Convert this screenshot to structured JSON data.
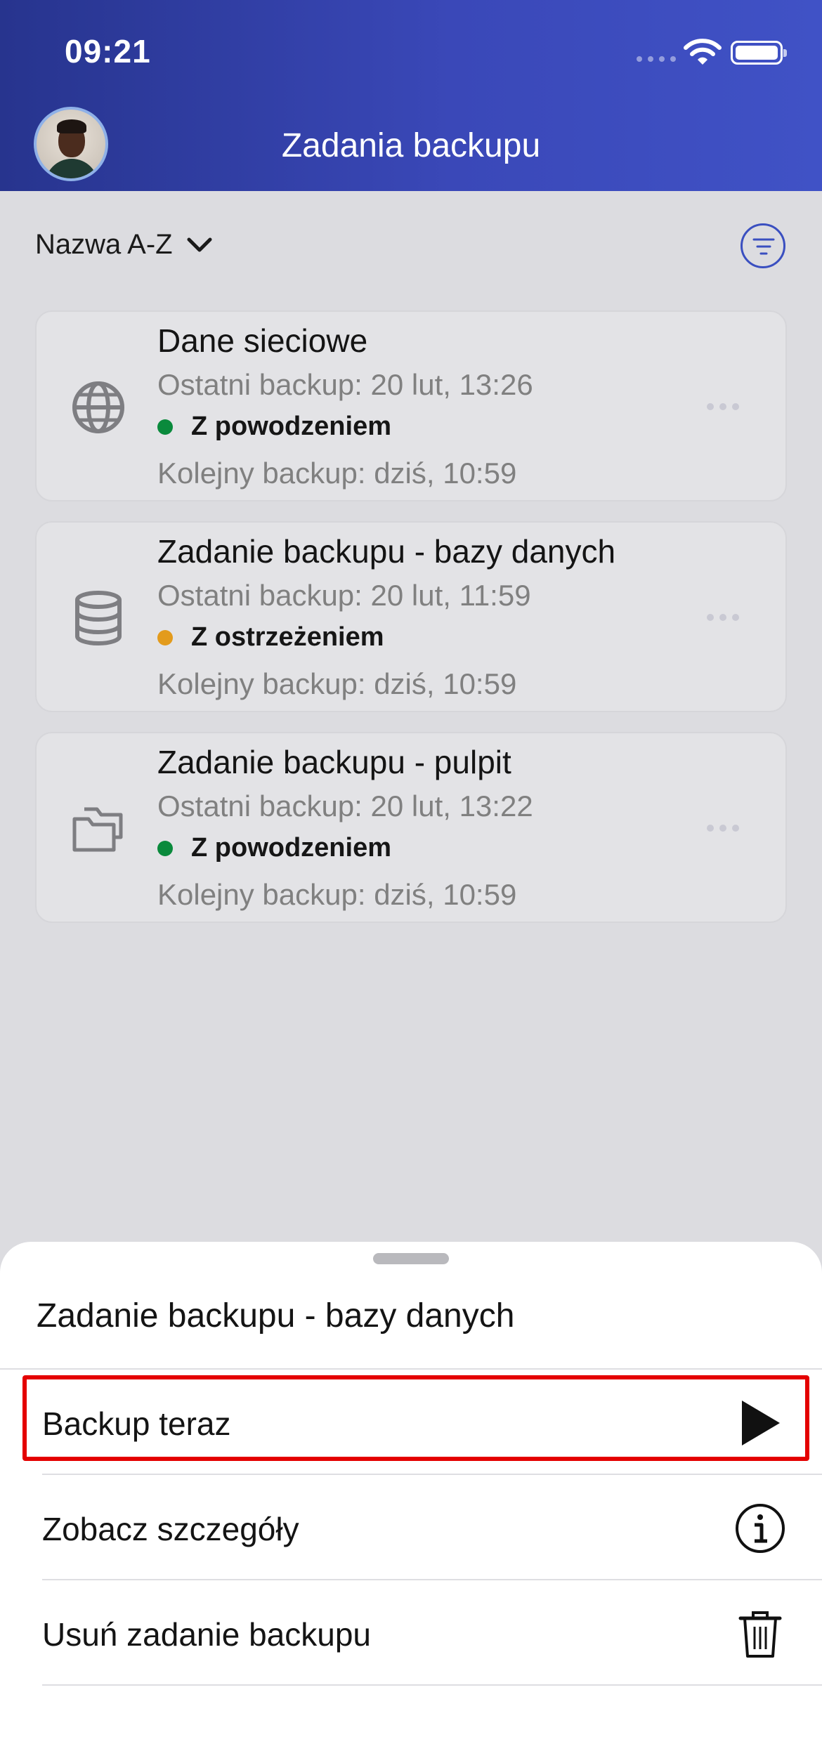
{
  "status_bar": {
    "time": "09:21"
  },
  "header": {
    "title": "Zadania backupu"
  },
  "sort": {
    "label": "Nazwa A-Z"
  },
  "jobs": [
    {
      "title": "Dane sieciowe",
      "last_backup": "Ostatni backup: 20 lut, 13:26",
      "status": "Z powodzeniem",
      "status_color": "#0a8a3c",
      "next_backup": "Kolejny backup: dziś, 10:59",
      "icon": "globe-icon"
    },
    {
      "title": "Zadanie backupu - bazy danych",
      "last_backup": "Ostatni backup: 20 lut, 11:59",
      "status": "Z ostrzeżeniem",
      "status_color": "#e39b1c",
      "next_backup": "Kolejny backup: dziś, 10:59",
      "icon": "database-icon"
    },
    {
      "title": "Zadanie backupu - pulpit",
      "last_backup": "Ostatni backup: 20 lut, 13:22",
      "status": "Z powodzeniem",
      "status_color": "#0a8a3c",
      "next_backup": "Kolejny backup: dziś, 10:59",
      "icon": "folders-icon"
    }
  ],
  "sheet": {
    "title": "Zadanie backupu - bazy danych",
    "actions": [
      {
        "label": "Backup teraz",
        "icon": "play-icon"
      },
      {
        "label": "Zobacz szczegóły",
        "icon": "info-icon"
      },
      {
        "label": "Usuń zadanie backupu",
        "icon": "trash-icon"
      }
    ]
  },
  "colors": {
    "header_start": "#27348e",
    "header_end": "#4052c6",
    "accent": "#3a4fc0",
    "highlight": "#e40000"
  }
}
